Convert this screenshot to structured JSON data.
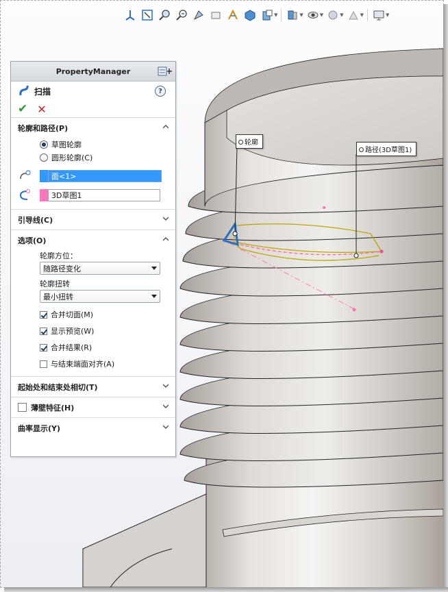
{
  "toolbar": {
    "icons": [
      "standard-views-icon",
      "zoom-to-fit-icon",
      "zoom-to-area-icon",
      "previous-view-icon",
      "section-view-icon",
      "dynamic-annotation-icon",
      "view-orientation-icon",
      "display-style-icon",
      "hide-show-items-icon",
      "edit-appearance-icon",
      "apply-scene-icon",
      "view-settings-icon",
      "monitor-icon"
    ]
  },
  "property_manager": {
    "header_title": "PropertyManager",
    "feature_title": "扫描",
    "groups": {
      "profile_path": {
        "title": "轮廓和路径(P)",
        "radio_sketch": "草图轮廓",
        "radio_circular": "圆形轮廓(C)",
        "profile_value": "面<1>",
        "path_value": "3D草图1"
      },
      "guides": {
        "title": "引导线(C)"
      },
      "options": {
        "title": "选项(O)",
        "orientation_label": "轮廓方位：",
        "orientation_value": "随路径变化",
        "twist_label": "轮廓扭转",
        "twist_value": "最小扭转",
        "checks": [
          {
            "label": "合并切面(M)",
            "checked": true
          },
          {
            "label": "显示预览(W)",
            "checked": true
          },
          {
            "label": "合并结果(R)",
            "checked": true
          },
          {
            "label": "与结束端面对齐(A)",
            "checked": false
          }
        ]
      },
      "tangency": {
        "title": "起始处和结束处相切(T)"
      },
      "thin": {
        "title": "薄壁特征(H)"
      },
      "curvature": {
        "title": "曲率显示(Y)"
      }
    }
  },
  "viewport": {
    "callout_profile": "轮廓",
    "callout_path": "路径(3D草图1)"
  },
  "colors": {
    "selection_blue": "#3399ff",
    "profile_chip": "#3399ff",
    "path_chip": "#ff77bb",
    "accent": "#2a6fc0"
  }
}
